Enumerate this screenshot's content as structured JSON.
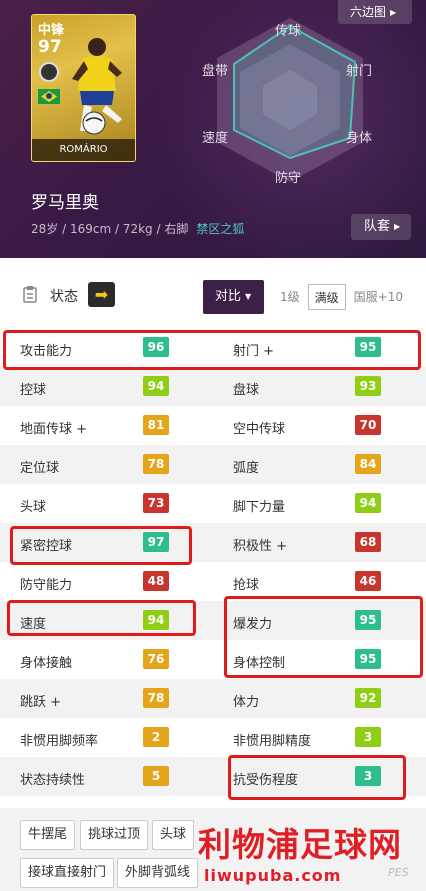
{
  "header": {
    "hexagon_button": "六边图",
    "team_button": "队套",
    "card": {
      "position": "中锋",
      "overall": "97",
      "card_name": "ROMÁRIO"
    },
    "name": "罗马里奥",
    "info": "28岁 / 169cm / 72kg / 右脚",
    "tag": "禁区之狐",
    "radar_labels": {
      "top": "传球",
      "top_left": "盘带",
      "top_right": "射门",
      "bottom_left": "速度",
      "bottom_right": "身体",
      "bottom": "防守"
    }
  },
  "toolbar": {
    "status_label": "状态",
    "compare_label": "对比",
    "levels": [
      "1级",
      "满级",
      "国服+10"
    ],
    "selected_level": "满级"
  },
  "stats": [
    [
      {
        "label": "攻击能力",
        "value": "96",
        "color": "#2ebd8f"
      },
      {
        "label": "射门 +",
        "value": "95",
        "color": "#2ebd8f"
      }
    ],
    [
      {
        "label": "控球",
        "value": "94",
        "color": "#8fce14"
      },
      {
        "label": "盘球",
        "value": "93",
        "color": "#8fce14"
      }
    ],
    [
      {
        "label": "地面传球 +",
        "value": "81",
        "color": "#e4a51a"
      },
      {
        "label": "空中传球",
        "value": "70",
        "color": "#c8352e"
      }
    ],
    [
      {
        "label": "定位球",
        "value": "78",
        "color": "#e4a51a"
      },
      {
        "label": "弧度",
        "value": "84",
        "color": "#e4a51a"
      }
    ],
    [
      {
        "label": "头球",
        "value": "73",
        "color": "#c8352e"
      },
      {
        "label": "脚下力量",
        "value": "94",
        "color": "#8fce14"
      }
    ],
    [
      {
        "label": "紧密控球",
        "value": "97",
        "color": "#2ebd8f"
      },
      {
        "label": "积极性 +",
        "value": "68",
        "color": "#c8352e"
      }
    ],
    [
      {
        "label": "防守能力",
        "value": "48",
        "color": "#c8352e"
      },
      {
        "label": "抢球",
        "value": "46",
        "color": "#c8352e"
      }
    ],
    [
      {
        "label": "速度",
        "value": "94",
        "color": "#8fce14"
      },
      {
        "label": "爆发力",
        "value": "95",
        "color": "#2ebd8f"
      }
    ],
    [
      {
        "label": "身体接触",
        "value": "76",
        "color": "#e4a51a"
      },
      {
        "label": "身体控制",
        "value": "95",
        "color": "#2ebd8f"
      }
    ],
    [
      {
        "label": "跳跃 +",
        "value": "78",
        "color": "#e4a51a"
      },
      {
        "label": "体力",
        "value": "92",
        "color": "#8fce14"
      }
    ],
    [
      {
        "label": "非惯用脚频率",
        "value": "2",
        "color": "#e4a51a"
      },
      {
        "label": "非惯用脚精度",
        "value": "3",
        "color": "#8fce14"
      }
    ],
    [
      {
        "label": "状态持续性",
        "value": "5",
        "color": "#e4a51a"
      },
      {
        "label": "抗受伤程度",
        "value": "3",
        "color": "#2ebd8f"
      }
    ]
  ],
  "skills": [
    "牛摆尾",
    "挑球过顶",
    "头球",
    "接球直接射门",
    "外脚背弧线"
  ],
  "watermark": {
    "title": "利物浦足球网",
    "url": "liwupuba.com",
    "corner": "PES"
  }
}
